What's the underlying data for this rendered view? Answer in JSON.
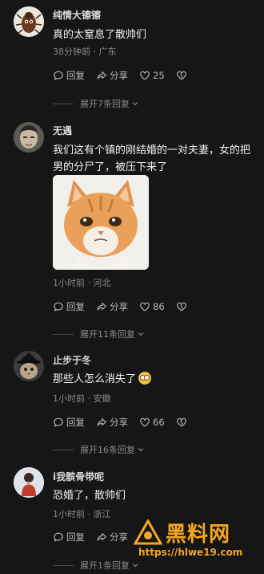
{
  "comments": [
    {
      "username": "纯情大镲镲",
      "text": "真的太窒息了散帅们",
      "meta": "38分钟前 · 广东",
      "reply_label": "回复",
      "share_label": "分享",
      "likes": "25",
      "expand_label": "展开7条回复"
    },
    {
      "username": "无遇",
      "text": "我们这有个镇的刚结婚的一对夫妻，女的把男的分尸了，被压下来了",
      "meta": "1小时前 · 河北",
      "reply_label": "回复",
      "share_label": "分享",
      "likes": "86",
      "expand_label": "展开11条回复"
    },
    {
      "username": "止步于冬",
      "text": "那些人怎么消失了",
      "meta": "1小时前 · 安徽",
      "reply_label": "回复",
      "share_label": "分享",
      "likes": "66",
      "expand_label": "展开16条回复"
    },
    {
      "username": "i我髌骨带呢",
      "text": "恐婚了，散帅们",
      "meta": "1小时前 · 浙江",
      "reply_label": "回复",
      "share_label": "分享",
      "likes": "",
      "expand_label": "展开1条回复"
    }
  ],
  "watermark": {
    "title": "黑料网",
    "url": "https://hlwe19.com"
  },
  "colors": {
    "background": "#161616",
    "watermark": "#f5a623"
  }
}
